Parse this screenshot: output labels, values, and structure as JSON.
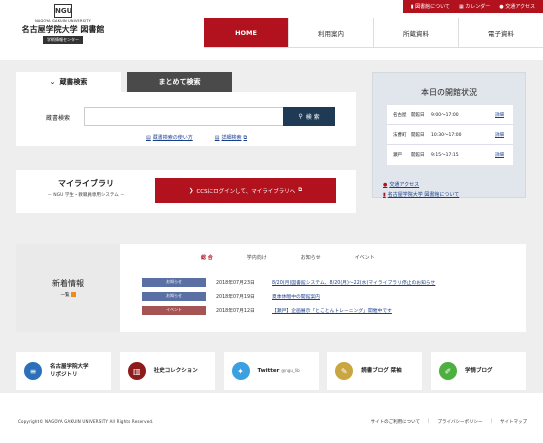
{
  "header": {
    "logo": {
      "mark": "NGU",
      "univ_en": "NAGOYA GAKUIN UNIVERSITY",
      "univ_ja": "名古屋学院大学 図書館",
      "center": "学術情報センター"
    },
    "utility": [
      {
        "icon": "book-icon",
        "label": "図書館について"
      },
      {
        "icon": "calendar-icon",
        "label": "カレンダー"
      },
      {
        "icon": "location-icon",
        "label": "交通アクセス"
      }
    ],
    "nav": [
      {
        "label": "HOME",
        "active": true
      },
      {
        "label": "利用案内",
        "active": false
      },
      {
        "label": "所蔵資料",
        "active": false
      },
      {
        "label": "電子資料",
        "active": false
      }
    ]
  },
  "search": {
    "tab_active": "蔵書検索",
    "tab_other": "まとめて検索",
    "label": "蔵書検索",
    "input_value": "",
    "button": "検 索",
    "links": [
      "蔵書検索の使い方",
      "詳細検索"
    ]
  },
  "mylibrary": {
    "title": "マイライブラリ",
    "subtitle": "－ NGU 学生・教職員専用システム －",
    "button": "CCSにログインして、マイライブラリへ"
  },
  "status": {
    "title": "本日の開館状況",
    "rows": [
      {
        "campus": "名古屋",
        "state": "開館日",
        "hours": "9:00〜17:00",
        "link": "詳細"
      },
      {
        "campus": "法曹町",
        "state": "開館日",
        "hours": "10:30〜17:00",
        "link": "詳細"
      },
      {
        "campus": "瀬戸",
        "state": "開館日",
        "hours": "9:15〜17:15",
        "link": "詳細"
      }
    ],
    "links": [
      "交通アクセス",
      "名古屋学院大学 図書館について"
    ]
  },
  "news": {
    "title": "新着情報",
    "sub": "一覧",
    "tabs": [
      "総 合",
      "学内向け",
      "お知らせ",
      "イベント"
    ],
    "items": [
      {
        "badge": "お知らせ",
        "badge_color": "#5a6fa3",
        "date": "2018年07月23日",
        "title": "8/20(月)図書館システム、8/20(月)〜22(水)マイライブラリ停止のお知らせ"
      },
      {
        "badge": "お知らせ",
        "badge_color": "#5a6fa3",
        "date": "2018年07月19日",
        "title": "夏季休暇中の開館案内"
      },
      {
        "badge": "イベント",
        "badge_color": "#a55454",
        "date": "2018年07月12日",
        "title": "【瀬戸】企画展示「とことんトレーニング」開催中です"
      }
    ]
  },
  "banners": [
    {
      "icon": "database-icon",
      "color": "#2d6fb8",
      "label": "名古屋学院大学\nリポジトリ",
      "small": ""
    },
    {
      "icon": "books-icon",
      "color": "#8e1b1b",
      "label": "社史コレクション",
      "small": ""
    },
    {
      "icon": "twitter-icon",
      "color": "#3aa0e0",
      "label": "Twitter",
      "small": "@ngu_lib"
    },
    {
      "icon": "blog-icon",
      "color": "#c9a640",
      "label": "読書ブログ 栞袖",
      "small": ""
    },
    {
      "icon": "pen-icon",
      "color": "#4caf3f",
      "label": "学情ブログ",
      "small": ""
    }
  ],
  "footer": {
    "copyright": "Copyright© NAGOYA GAKUIN UNIVERSITY All Rights Reserved.",
    "links": [
      "サイトのご利用について",
      "プライバシーポリシー",
      "サイトマップ"
    ]
  }
}
